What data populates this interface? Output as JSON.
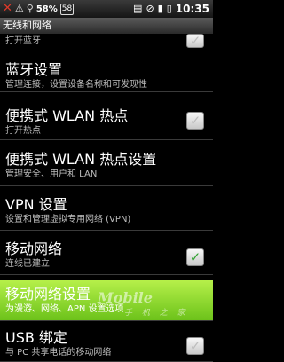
{
  "status_bar": {
    "battery_percent": "58%",
    "badge": "58",
    "time": "10:35",
    "icons": [
      "x-icon",
      "warning-icon",
      "usb-icon",
      "battery-badge",
      "sd-icon",
      "no-signal-icon",
      "signal-icon",
      "battery-icon"
    ]
  },
  "title": "无线和网络",
  "items": [
    {
      "subtitle": "打开蓝牙"
    },
    {
      "title": "蓝牙设置",
      "subtitle": "管理连接，设置设备名称和可发现性"
    },
    {
      "title": "便携式 WLAN 热点",
      "subtitle": "打开热点"
    },
    {
      "title": "便携式 WLAN 热点设置",
      "subtitle": "管理安全、用户和 LAN"
    },
    {
      "title": "VPN 设置",
      "subtitle": "设置和管理虚拟专用网络 (VPN)"
    },
    {
      "title": "移动网络",
      "subtitle": "连线已建立"
    },
    {
      "title": "移动网络设置",
      "subtitle": "为漫游、网络、APN 设置选项"
    },
    {
      "title": "USB 绑定",
      "subtitle": "与 PC 共享电话的移动网络"
    }
  ],
  "watermark": {
    "logo": "Mobile",
    "sub": "手 机 之 家"
  },
  "colors": {
    "highlight": "#8ed62a",
    "check": "#2fa22f"
  }
}
